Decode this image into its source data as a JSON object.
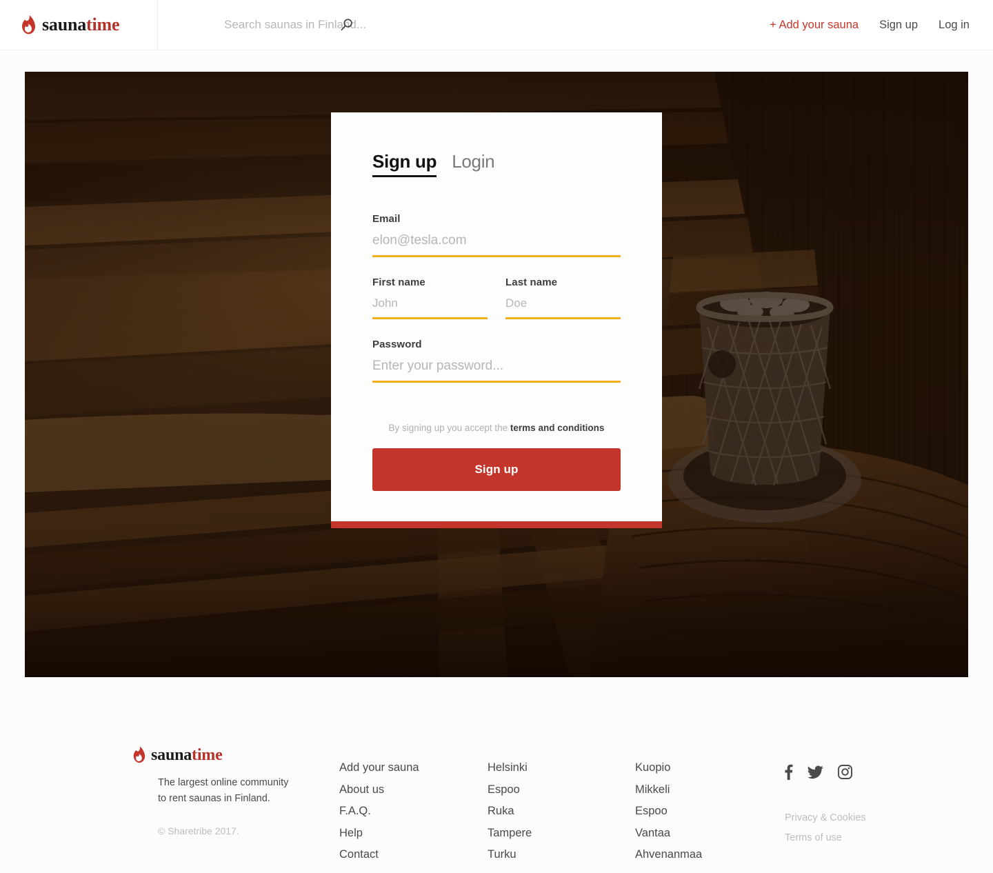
{
  "brand": {
    "name_part1": "sauna",
    "name_part2": "time",
    "icon": "flame-icon",
    "accent_color": "#b5332a"
  },
  "header": {
    "search": {
      "icon": "search-icon",
      "placeholder": "Search saunas in Finland...",
      "value": ""
    },
    "nav": [
      {
        "label": "+ Add your sauna",
        "accent": true
      },
      {
        "label": "Sign up",
        "accent": false
      },
      {
        "label": "Log in",
        "accent": false
      }
    ]
  },
  "hero": {
    "alt": "Dark sauna interior with wooden benches and a stone-filled sauna stove"
  },
  "auth": {
    "tabs": [
      {
        "label": "Sign up",
        "active": true
      },
      {
        "label": "Login",
        "active": false
      }
    ],
    "fields": {
      "email": {
        "label": "Email",
        "placeholder": "elon@tesla.com",
        "value": ""
      },
      "first_name": {
        "label": "First name",
        "placeholder": "John",
        "value": ""
      },
      "last_name": {
        "label": "Last name",
        "placeholder": "Doe",
        "value": ""
      },
      "password": {
        "label": "Password",
        "placeholder": "Enter your password...",
        "value": ""
      }
    },
    "terms_prefix": "By signing up you accept the ",
    "terms_link": "terms and conditions",
    "submit_label": "Sign up",
    "underline_color": "#f4ae17",
    "button_color": "#c4362c"
  },
  "footer": {
    "tagline": "The largest online community\nto rent saunas in Finland.",
    "copyright": "© Sharetribe 2017.",
    "columns": [
      {
        "items": [
          "Add your sauna",
          "About us",
          "F.A.Q.",
          "Help",
          "Contact"
        ]
      },
      {
        "items": [
          "Helsinki",
          "Espoo",
          "Ruka",
          "Tampere",
          "Turku"
        ]
      },
      {
        "items": [
          "Kuopio",
          "Mikkeli",
          "Espoo",
          "Vantaa",
          "Ahvenanmaa"
        ]
      }
    ],
    "social": [
      "facebook-icon",
      "twitter-icon",
      "instagram-icon"
    ],
    "legal": [
      "Privacy & Cookies",
      "Terms of use"
    ]
  }
}
